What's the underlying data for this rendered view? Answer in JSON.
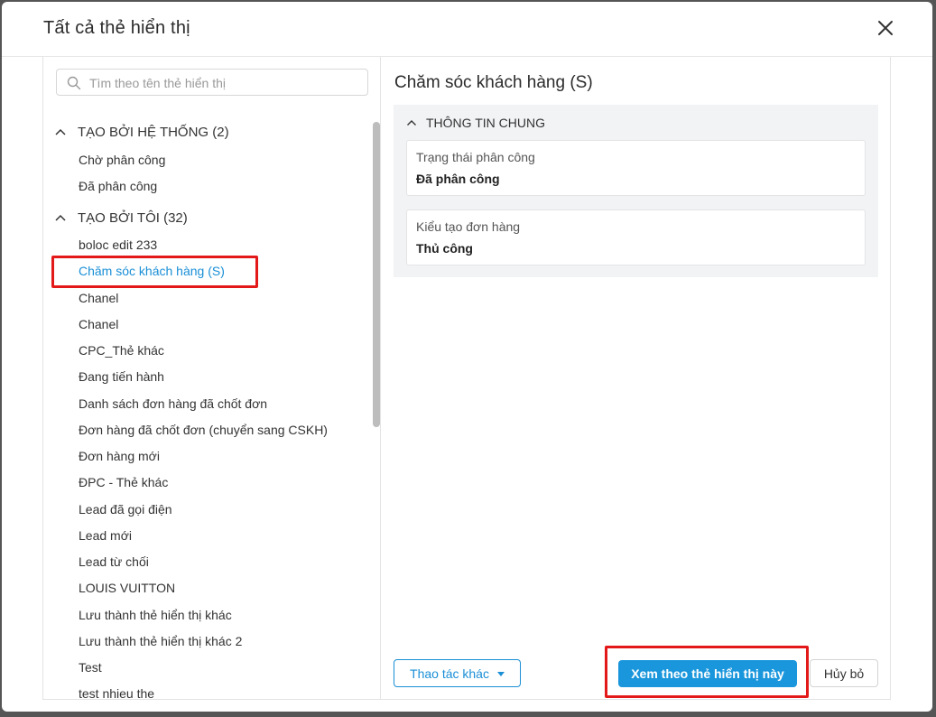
{
  "dialog": {
    "title": "Tất cả thẻ hiển thị",
    "close_icon": "close-icon"
  },
  "search": {
    "placeholder": "Tìm theo tên thẻ hiển thị",
    "value": ""
  },
  "groups": [
    {
      "label": "TẠO BỞI HỆ THỐNG (2)",
      "items": [
        "Chờ phân công",
        "Đã phân công"
      ]
    },
    {
      "label": "TẠO BỞI TÔI (32)",
      "items": [
        "boloc edit 233",
        "Chăm sóc khách hàng (S)",
        "Chanel",
        "Chanel",
        "CPC_Thẻ khác",
        "Đang tiến hành",
        "Danh sách đơn hàng đã chốt đơn",
        "Đơn hàng đã chốt đơn (chuyển sang CSKH)",
        "Đơn hàng mới",
        "ĐPC - Thẻ khác",
        "Lead đã gọi điện",
        "Lead mới",
        "Lead từ chối",
        "LOUIS VUITTON",
        "Lưu thành thẻ hiển thị khác",
        "Lưu thành thẻ hiển thị khác 2",
        "Test",
        "test nhieu the"
      ]
    }
  ],
  "selected_item": "Chăm sóc khách hàng (S)",
  "detail": {
    "title": "Chăm sóc khách hàng (S)",
    "section_title": "THÔNG TIN CHUNG",
    "fields": [
      {
        "label": "Trạng thái phân công",
        "value": "Đã phân công"
      },
      {
        "label": "Kiểu tạo đơn hàng",
        "value": "Thủ công"
      }
    ]
  },
  "footer": {
    "more_actions_label": "Thao tác khác",
    "primary_label": "Xem theo thẻ hiển thị này",
    "cancel_label": "Hủy bỏ"
  },
  "colors": {
    "accent": "#1a96dc",
    "highlight": "#e31919",
    "panel_bg": "#f2f3f5"
  }
}
